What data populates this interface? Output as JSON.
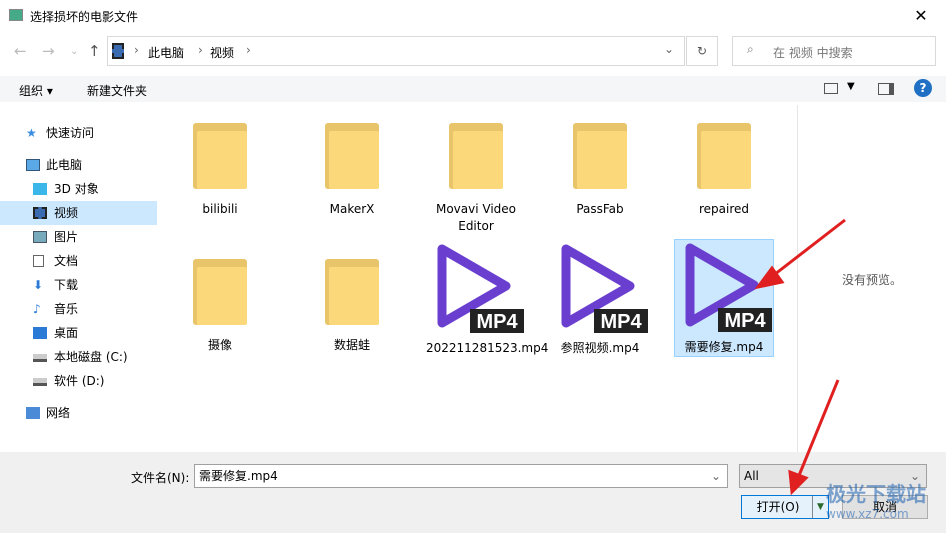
{
  "window": {
    "title": "选择损坏的电影文件",
    "close": "✕"
  },
  "address": {
    "crumbs": [
      "此电脑",
      "视频"
    ],
    "search_placeholder": "在 视频 中搜索"
  },
  "toolbar": {
    "organize": "组织",
    "new_folder": "新建文件夹",
    "help": "?"
  },
  "sidebar": {
    "items": [
      {
        "label": "快速访问",
        "icon": "star-icon"
      },
      {
        "label": "此电脑",
        "icon": "computer-icon"
      },
      {
        "label": "3D 对象",
        "icon": "cube-icon"
      },
      {
        "label": "视频",
        "icon": "film-icon",
        "selected": true
      },
      {
        "label": "图片",
        "icon": "picture-icon"
      },
      {
        "label": "文档",
        "icon": "document-icon"
      },
      {
        "label": "下载",
        "icon": "download-icon"
      },
      {
        "label": "音乐",
        "icon": "music-icon"
      },
      {
        "label": "桌面",
        "icon": "desktop-icon"
      },
      {
        "label": "本地磁盘 (C:)",
        "icon": "drive-icon"
      },
      {
        "label": "软件 (D:)",
        "icon": "drive-icon"
      },
      {
        "label": "网络",
        "icon": "network-icon"
      }
    ]
  },
  "files": [
    {
      "name": "bilibili",
      "type": "folder"
    },
    {
      "name": "MakerX",
      "type": "folder"
    },
    {
      "name": "Movavi Video Editor",
      "type": "folder"
    },
    {
      "name": "PassFab",
      "type": "folder"
    },
    {
      "name": "repaired",
      "type": "folder"
    },
    {
      "name": "摄像",
      "type": "folder"
    },
    {
      "name": "数据蛙",
      "type": "folder"
    },
    {
      "name": "202211281523.mp4",
      "type": "mp4"
    },
    {
      "name": "参照视频.mp4",
      "type": "mp4"
    },
    {
      "name": "需要修复.mp4",
      "type": "mp4",
      "selected": true
    }
  ],
  "mp4_badge": "MP4",
  "preview": {
    "text": "没有预览。"
  },
  "bottom": {
    "filename_label": "文件名(N):",
    "filename_value": "需要修复.mp4",
    "filter": "All",
    "open": "打开(O)",
    "cancel": "取消"
  },
  "watermark": {
    "brand": "极光下载站",
    "url": "www.xz7.com"
  },
  "colors": {
    "accent": "#cce8ff",
    "play": "#6a3fd0",
    "arrow": "#e02020"
  }
}
